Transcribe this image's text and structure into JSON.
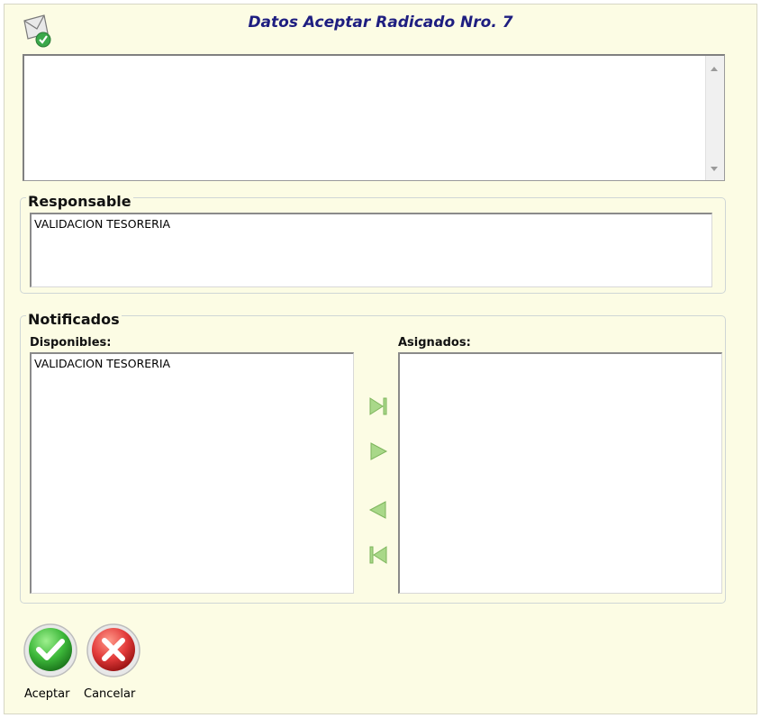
{
  "window": {
    "title": "Datos Aceptar Radicado Nro. 7"
  },
  "observaciones": {
    "value": ""
  },
  "responsable": {
    "group_label": "Responsable",
    "items": [
      "VALIDACION TESORERIA"
    ]
  },
  "notificados": {
    "group_label": "Notificados",
    "disponibles_label": "Disponibles:",
    "disponibles_items": [
      "VALIDACION TESORERIA"
    ],
    "asignados_label": "Asignados:",
    "asignados_items": []
  },
  "transfer_buttons": {
    "icons": [
      "move-all-right-icon",
      "move-right-icon",
      "move-left-icon",
      "move-all-left-icon"
    ]
  },
  "actions": {
    "accept_label": "Aceptar",
    "cancel_label": "Cancelar"
  },
  "colors": {
    "background": "#fcfce4",
    "title": "#1e1e80",
    "arrow_green": "#9ed07a",
    "accept_green": "#3db83a",
    "cancel_red": "#e23a3a"
  }
}
